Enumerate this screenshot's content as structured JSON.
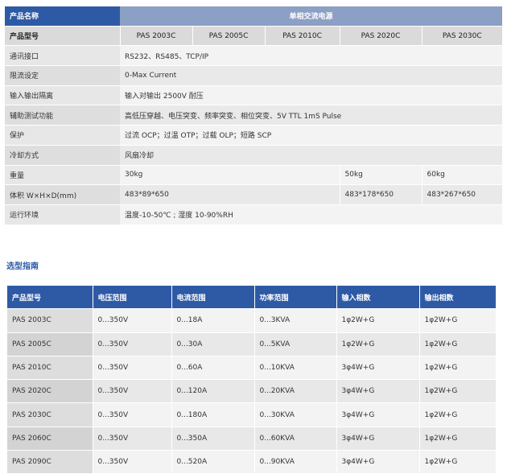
{
  "spec": {
    "header_label": "产品名称",
    "title": "单相交流电源",
    "model_label": "产品型号",
    "models": [
      "PAS 2003C",
      "PAS 2005C",
      "PAS 2010C",
      "PAS 2020C",
      "PAS 2030C"
    ],
    "rows": [
      {
        "label": "通讯接口",
        "value": "RS232、RS485、TCP/IP"
      },
      {
        "label": "限流设定",
        "value": "0-Max Current"
      },
      {
        "label": "输入输出隔离",
        "value": "输入对输出 2500V 耐压"
      },
      {
        "label": "辅助测试功能",
        "value": "高低压穿越、电压突变、频率突变、相位突变、5V TTL 1mS Pulse"
      },
      {
        "label": "保护",
        "value": "过流 OCP；过温 OTP；过载 OLP；短路 SCP"
      },
      {
        "label": "冷却方式",
        "value": "风扇冷却"
      }
    ],
    "weight": {
      "label": "重量",
      "values": [
        "30kg",
        "50kg",
        "60kg"
      ]
    },
    "dimension": {
      "label": "体积 W×H×D(mm)",
      "values": [
        "483*89*650",
        "483*178*650",
        "483*267*650"
      ]
    },
    "environment": {
      "label": "运行环境",
      "value": "温度-10-50℃ ; 湿度 10-90%RH"
    }
  },
  "guide": {
    "title": "选型指南",
    "headers": [
      "产品型号",
      "电压范围",
      "电流范围",
      "功率范围",
      "输入相数",
      "输出相数"
    ],
    "rows": [
      [
        "PAS 2003C",
        "0...350V",
        "0...18A",
        "0...3KVA",
        "1φ2W+G",
        "1φ2W+G"
      ],
      [
        "PAS 2005C",
        "0...350V",
        "0...30A",
        "0...5KVA",
        "1φ2W+G",
        "1φ2W+G"
      ],
      [
        "PAS 2010C",
        "0...350V",
        "0...60A",
        "0...10KVA",
        "3φ4W+G",
        "1φ2W+G"
      ],
      [
        "PAS 2020C",
        "0...350V",
        "0...120A",
        "0...20KVA",
        "3φ4W+G",
        "1φ2W+G"
      ],
      [
        "PAS 2030C",
        "0...350V",
        "0...180A",
        "0...30KVA",
        "3φ4W+G",
        "1φ2W+G"
      ],
      [
        "PAS 2060C",
        "0...350V",
        "0...350A",
        "0...60KVA",
        "3φ4W+G",
        "1φ2W+G"
      ],
      [
        "PAS 2090C",
        "0...350V",
        "0...520A",
        "0...90KVA",
        "3φ4W+G",
        "1φ2W+G"
      ]
    ]
  }
}
